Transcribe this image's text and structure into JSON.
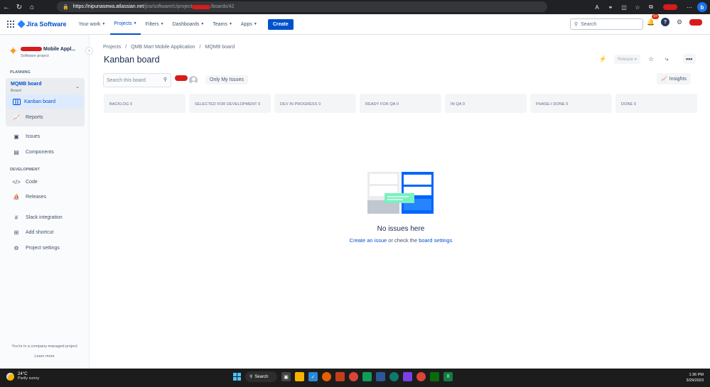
{
  "browser": {
    "url_host": "https://nipunasewa.atlassian.net",
    "url_path_start": "/jira/software/c/project",
    "url_path_end": "/boards/42",
    "nav_icons": [
      "back-icon",
      "refresh-icon",
      "home-icon"
    ],
    "toolbar_icons": [
      "read-aloud-icon",
      "tracking-icon",
      "extensions-icon",
      "favorites-icon",
      "collections-icon",
      "browser-essentials-icon",
      "copilot-icon"
    ]
  },
  "topnav": {
    "brand": "Jira Software",
    "menu": [
      {
        "label": "Your work",
        "active": false
      },
      {
        "label": "Projects",
        "active": true
      },
      {
        "label": "Filters",
        "active": false
      },
      {
        "label": "Dashboards",
        "active": false
      },
      {
        "label": "Teams",
        "active": false
      },
      {
        "label": "Apps",
        "active": false
      }
    ],
    "create_label": "Create",
    "search_placeholder": "Search",
    "notifications_badge": "9+",
    "help_glyph": "?"
  },
  "sidebar": {
    "project_name": "Mobile Appl...",
    "project_type": "Software project",
    "planning_label": "PLANNING",
    "board_name": "MQMB board",
    "board_type": "Board",
    "kanban_label": "Kanban board",
    "reports_label": "Reports",
    "issues_label": "Issues",
    "components_label": "Components",
    "development_label": "DEVELOPMENT",
    "code_label": "Code",
    "releases_label": "Releases",
    "slack_label": "Slack integration",
    "add_shortcut_label": "Add shortcut",
    "settings_label": "Project settings",
    "footer_text": "You're in a company-managed project",
    "learn_more": "Learn more"
  },
  "main": {
    "breadcrumbs": [
      "Projects",
      "QMB Mart Mobile Application",
      "MQMB board"
    ],
    "breadcrumb_sep": "/",
    "title": "Kanban board",
    "release_label": "Release",
    "more_label": "•••",
    "search_placeholder": "Search this board",
    "only_my_issues": "Only My Issues",
    "insights_label": "Insights",
    "columns": [
      {
        "name": "BACKLOG",
        "count": "0"
      },
      {
        "name": "SELECTED FOR DEVELOPMENT",
        "count": "0"
      },
      {
        "name": "DEV IN PROGRESS",
        "count": "0"
      },
      {
        "name": "READY FOR QA",
        "count": "0"
      },
      {
        "name": "IN QA",
        "count": "0"
      },
      {
        "name": "PHASE-I DONE",
        "count": "0"
      },
      {
        "name": "DONE",
        "count": "0"
      }
    ],
    "empty_title": "No issues here",
    "empty_link_create": "Create an issue",
    "empty_middle": " or check the ",
    "empty_link_settings": "board settings"
  },
  "taskbar": {
    "temperature": "24°C",
    "weather": "Partly sunny",
    "search_label": "Search",
    "time": "1:36 PM",
    "date": "3/29/2023"
  },
  "colors": {
    "brand_blue": "#0052cc",
    "selected_bg": "#deebff",
    "redaction": "#d81b1b"
  }
}
